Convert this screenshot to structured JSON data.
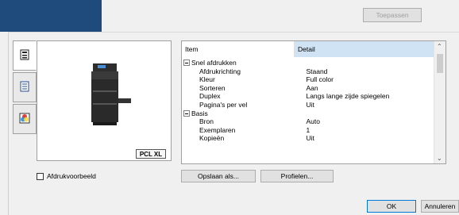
{
  "toolbar": {
    "apply_label": "Toepassen"
  },
  "tabs": [
    {
      "icon": "printer-settings-icon"
    },
    {
      "icon": "document-icon"
    },
    {
      "icon": "color-icon"
    }
  ],
  "preview": {
    "badge": "PCL XL",
    "checkbox_label": "Afdrukvoorbeeld",
    "checked": false
  },
  "table": {
    "columns": [
      "Item",
      "Detail"
    ],
    "rows": [
      {
        "type": "group",
        "item": "Snel afdrukken",
        "detail": ""
      },
      {
        "type": "sub",
        "item": "Afdrukrichting",
        "detail": "Staand"
      },
      {
        "type": "sub",
        "item": "Kleur",
        "detail": "Full color"
      },
      {
        "type": "sub",
        "item": "Sorteren",
        "detail": "Aan"
      },
      {
        "type": "sub",
        "item": "Duplex",
        "detail": "Langs lange zijde spiegelen"
      },
      {
        "type": "sub",
        "item": "Pagina's per vel",
        "detail": "Uit"
      },
      {
        "type": "group",
        "item": "Basis",
        "detail": ""
      },
      {
        "type": "sub",
        "item": "Bron",
        "detail": "Auto"
      },
      {
        "type": "sub",
        "item": "Exemplaren",
        "detail": "1"
      },
      {
        "type": "sub",
        "item": "Kopieën",
        "detail": "Uit"
      }
    ]
  },
  "actions": {
    "save_as": "Opslaan als...",
    "profiles": "Profielen..."
  },
  "dialog": {
    "ok": "OK",
    "cancel": "Annuleren"
  },
  "colors": {
    "brand": "#1e4a7c",
    "header_selected": "#cfe3f5",
    "primary_border": "#0078d7"
  }
}
